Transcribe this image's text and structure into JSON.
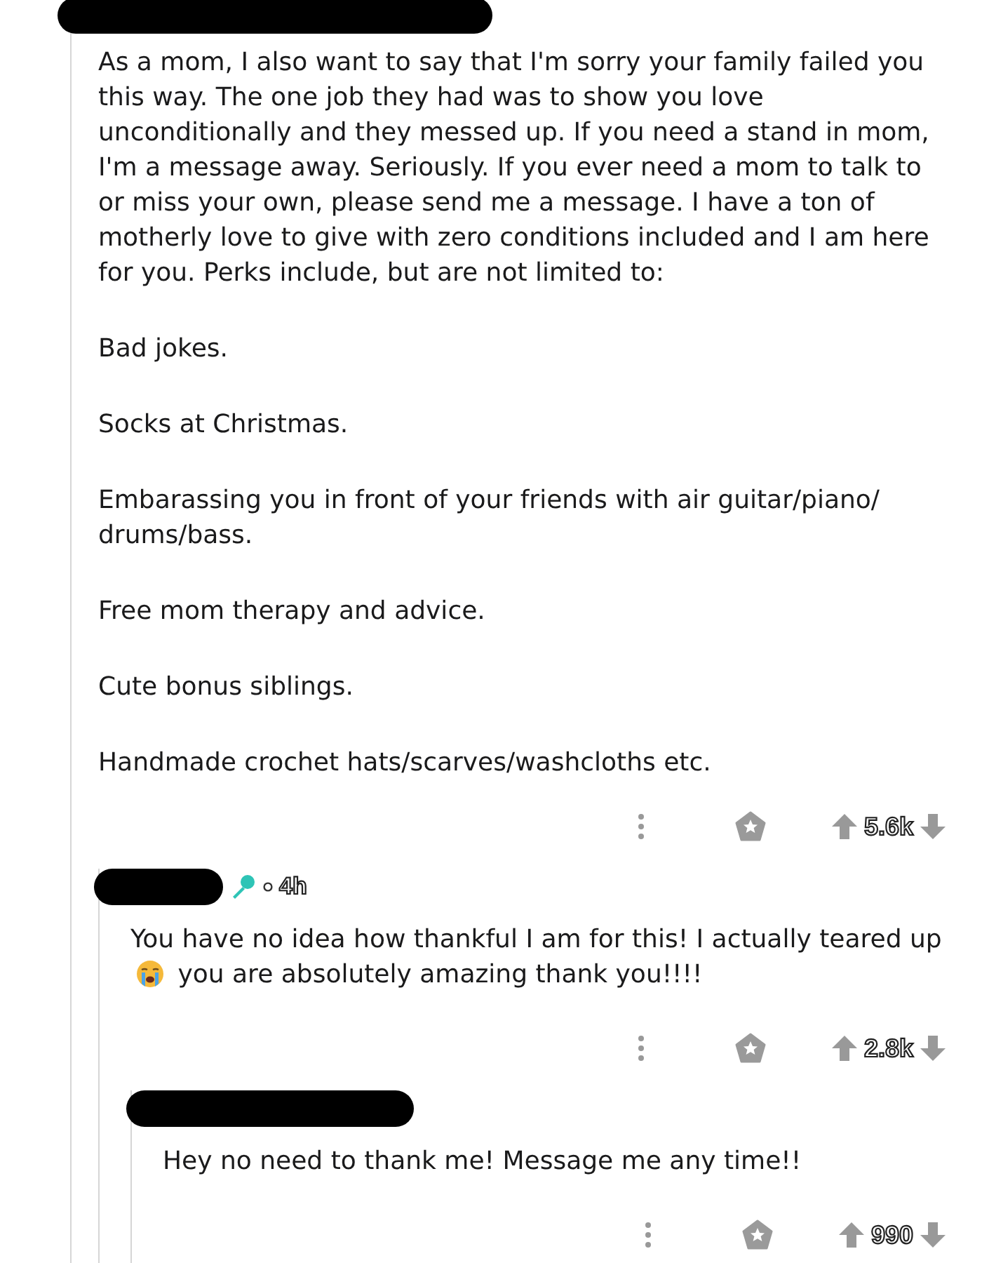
{
  "comments": [
    {
      "redacted_author": true,
      "badge": false,
      "paragraphs": [
        [
          {
            "kind": "text",
            "text": "As a mom, I also want to say that I'm sorry your family failed you this way. The one job they had was to show you love unconditionally and they messed up. If you need a stand in mom, I'm a message away. Seriously. If you ever need a mom to talk to or miss your own, please send me a message. I have a ton of motherly love to give with zero conditions included and I am here for you. Perks include, but are not limited to:"
          }
        ],
        [
          {
            "kind": "text",
            "text": "Bad jokes."
          }
        ],
        [
          {
            "kind": "text",
            "text": "Socks at Christmas."
          }
        ],
        [
          {
            "kind": "text",
            "text": "Embarassing you in front of your friends with air guitar/piano/ drums/bass."
          }
        ],
        [
          {
            "kind": "text",
            "text": "Free mom therapy and advice."
          }
        ],
        [
          {
            "kind": "text",
            "text": "Cute bonus siblings."
          }
        ],
        [
          {
            "kind": "text",
            "text": "Handmade crochet hats/scarves/washcloths etc."
          }
        ]
      ],
      "score": "5.6k",
      "children": [
        {
          "redacted_author": true,
          "badge": true,
          "time": "4h",
          "paragraphs": [
            [
              {
                "kind": "text",
                "text": "You have no idea how thankful I am for this! I actually teared up"
              },
              {
                "kind": "emoji"
              },
              {
                "kind": "text",
                "text": "you are absolutely amazing thank you!!!!"
              }
            ]
          ],
          "score": "2.8k",
          "children": [
            {
              "redacted_author": true,
              "badge": false,
              "paragraphs": [
                [
                  {
                    "kind": "text",
                    "text": "Hey no need to thank me! Message me any time!!"
                  }
                ]
              ],
              "score": "990"
            }
          ]
        }
      ]
    }
  ]
}
